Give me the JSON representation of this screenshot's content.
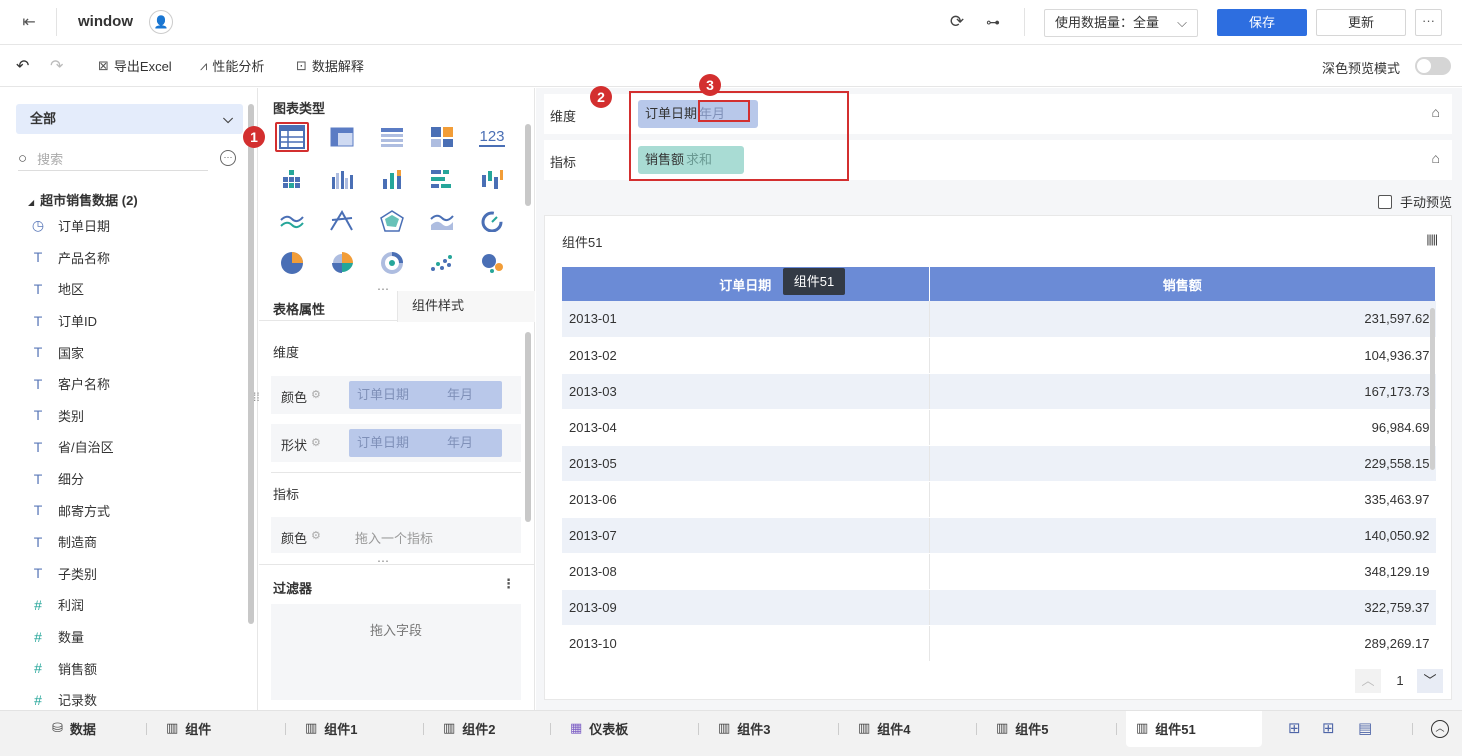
{
  "app": {
    "title": "window"
  },
  "top": {
    "dataset_label": "使用数据量：全量",
    "save": "保存",
    "update": "更新",
    "more": "···"
  },
  "toolbar": {
    "export_excel": "导出Excel",
    "performance": "性能分析",
    "explain": "数据解释",
    "dark_preview": "深色预览模式"
  },
  "left": {
    "scope": "全部",
    "search_placeholder": "搜索",
    "group": "超市销售数据 (2)",
    "fields": [
      {
        "type": "date",
        "label": "订单日期"
      },
      {
        "type": "text",
        "label": "产品名称"
      },
      {
        "type": "text",
        "label": "地区"
      },
      {
        "type": "text",
        "label": "订单ID"
      },
      {
        "type": "text",
        "label": "国家"
      },
      {
        "type": "text",
        "label": "客户名称"
      },
      {
        "type": "text",
        "label": "类别"
      },
      {
        "type": "text",
        "label": "省/自治区"
      },
      {
        "type": "text",
        "label": "细分"
      },
      {
        "type": "text",
        "label": "邮寄方式"
      },
      {
        "type": "text",
        "label": "制造商"
      },
      {
        "type": "text",
        "label": "子类别"
      },
      {
        "type": "number",
        "label": "利润"
      },
      {
        "type": "number",
        "label": "数量"
      },
      {
        "type": "number",
        "label": "销售额"
      },
      {
        "type": "number-calc",
        "label": "记录数"
      }
    ]
  },
  "mid": {
    "chart_type_title": "图表类型",
    "chart_icons": [
      "table-icon",
      "cross-table-icon",
      "detail-table-icon",
      "multi-block-icon",
      "number-card-icon",
      "dot-matrix-icon",
      "grouped-bar-icon",
      "stacked-bar-icon",
      "horizontal-bar-icon",
      "range-bar-icon",
      "line-chart-icon",
      "star-line-icon",
      "radar-icon",
      "area-chart-icon",
      "gauge-icon",
      "pie-chart-icon",
      "rose-chart-icon",
      "donut-chart-icon",
      "scatter-icon",
      "bubble-icon"
    ],
    "number_card_text": "123",
    "tab_table": "表格属性",
    "tab_style": "组件样式",
    "dimension": "维度",
    "color": "颜色",
    "shape": "形状",
    "pill_field": "订单日期",
    "pill_gran": "年月",
    "measure": "指标",
    "drag_measure": "拖入一个指标",
    "filter": "过滤器",
    "filter_more": "⋮",
    "drag_field": "拖入字段"
  },
  "right": {
    "dim_label": "维度",
    "dim_field": "订单日期",
    "dim_gran": "年月",
    "meas_label": "指标",
    "meas_field": "销售额",
    "meas_agg": "求和",
    "badges": [
      "1",
      "2",
      "3"
    ],
    "manual_preview": "手动预览",
    "component_title": "组件51",
    "tooltip": "组件51",
    "table": {
      "headers": [
        "订单日期",
        "销售额"
      ],
      "rows": [
        [
          "2013-01",
          "231,597.62"
        ],
        [
          "2013-02",
          "104,936.37"
        ],
        [
          "2013-03",
          "167,173.73"
        ],
        [
          "2013-04",
          "96,984.69"
        ],
        [
          "2013-05",
          "229,558.15"
        ],
        [
          "2013-06",
          "335,463.97"
        ],
        [
          "2013-07",
          "140,050.92"
        ],
        [
          "2013-08",
          "348,129.19"
        ],
        [
          "2013-09",
          "322,759.37"
        ],
        [
          "2013-10",
          "289,269.17"
        ]
      ]
    },
    "page": "1"
  },
  "bottom": {
    "tabs": [
      "数据",
      "组件",
      "组件1",
      "组件2",
      "仪表板",
      "组件3",
      "组件4",
      "组件5",
      "组件51"
    ],
    "active": "组件51"
  },
  "colors": {
    "primary": "#2d6ee0",
    "header": "#6b8bd6",
    "dim_pill": "#b8c8ea",
    "measure_pill": "#a9dcd4",
    "highlight": "#d32f2f"
  }
}
